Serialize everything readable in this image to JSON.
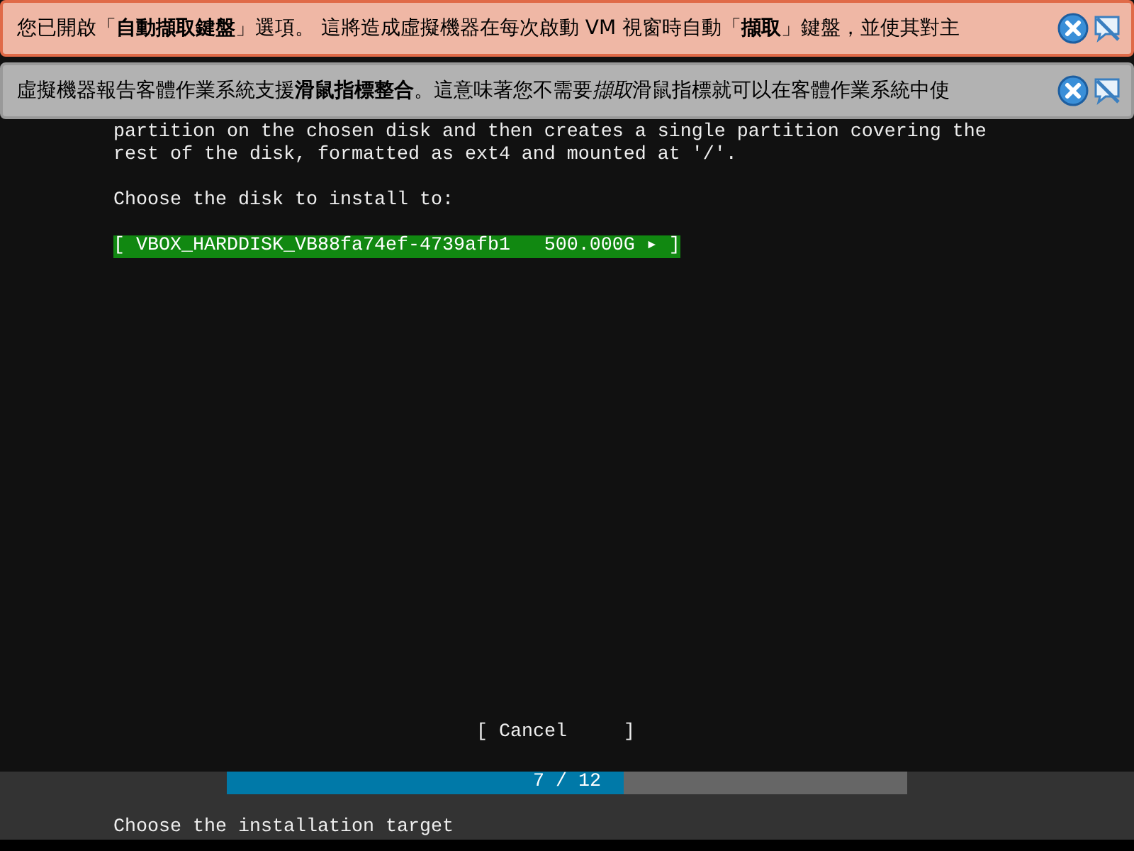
{
  "notifications": [
    {
      "kind": "warning",
      "parts": [
        {
          "kind": "plain",
          "text": "您已開啟「"
        },
        {
          "kind": "bold",
          "text": "自動擷取鍵盤"
        },
        {
          "kind": "plain",
          "text": "」選項。 這將造成虛擬機器在每次啟動 VM 視窗時自動「"
        },
        {
          "kind": "bold",
          "text": "擷取"
        },
        {
          "kind": "plain",
          "text": "」鍵盤，並使其對主"
        }
      ]
    },
    {
      "kind": "info",
      "parts": [
        {
          "kind": "plain",
          "text": "虛擬機器報告客體作業系統支援"
        },
        {
          "kind": "bold",
          "text": "滑鼠指標整合"
        },
        {
          "kind": "plain",
          "text": "。這意味著您不需要"
        },
        {
          "kind": "italic",
          "text": "擷取"
        },
        {
          "kind": "plain",
          "text": "滑鼠指標就可以在客體作業系統中使"
        }
      ]
    }
  ],
  "description": [
    "partition on the chosen disk and then creates a single partition covering the",
    "rest of the disk, formatted as ext4 and mounted at '/'."
  ],
  "prompt": "Choose the disk to install to:",
  "disks": [
    {
      "label": "[ VBOX_HARDDISK_VB88fa74ef-4739afb1   500.000G ▸ ]",
      "selected": true
    }
  ],
  "cancel_button": "[ Cancel     ]",
  "progress": {
    "level": 0.583,
    "reading": "7 / 12"
  },
  "status_text": "Choose the installation target"
}
